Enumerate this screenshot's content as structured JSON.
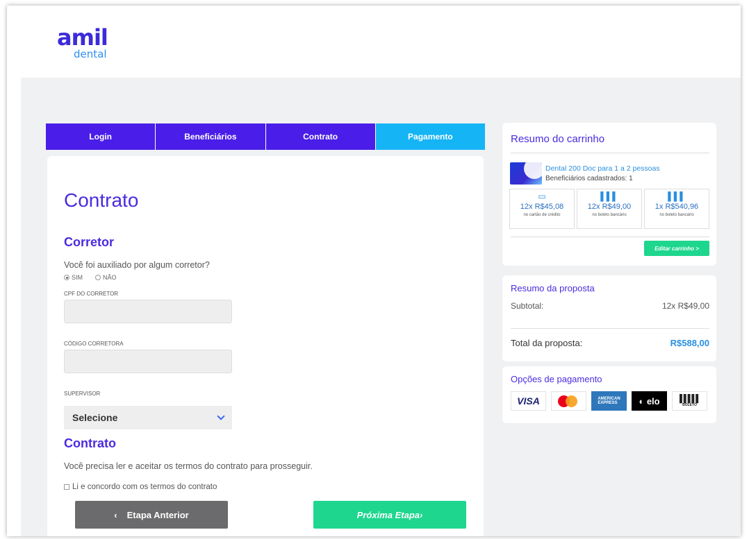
{
  "brand": {
    "name": "amil",
    "sub": "dental"
  },
  "steps": [
    {
      "label": "Login"
    },
    {
      "label": "Beneficiários"
    },
    {
      "label": "Contrato"
    },
    {
      "label": "Pagamento"
    }
  ],
  "form": {
    "title": "Contrato",
    "corretor": {
      "title": "Corretor",
      "question": "Você foi auxiliado por algum corretor?",
      "opt_yes": "SIM",
      "opt_no": "NÃO",
      "cpf_label": "CPF DO CORRETOR",
      "codigo_label": "CÓDIGO CORRETORA",
      "supervisor_label": "SUPERVISOR",
      "supervisor_value": "Selecione"
    },
    "contrato": {
      "title": "Contrato",
      "text": "Você precisa ler e aceitar os termos do contrato para prosseguir.",
      "checkbox": "Li e concordo com os termos do contrato"
    },
    "prev_button": "Etapa Anterior",
    "prev_arrow": "‹",
    "next_button": "Próxima Etapa›"
  },
  "cart": {
    "title": "Resumo do carrinho",
    "product": "Dental 200 Doc para 1 a 2 pessoas",
    "beneficiaries": "Beneficiários cadastrados: 1",
    "options": [
      {
        "icon": "credit-card-icon",
        "price": "12x R$45,08",
        "sub": "no cartão de crédito"
      },
      {
        "icon": "barcode-icon",
        "price": "12x R$49,00",
        "sub": "no boleto bancário"
      },
      {
        "icon": "barcode-icon",
        "price": "1x R$540,96",
        "sub": "no boleto bancário"
      }
    ],
    "edit_button": "Editar carrinho >"
  },
  "proposal": {
    "title": "Resumo da proposta",
    "subtotal_label": "Subtotal:",
    "subtotal_value": "12x R$49,00",
    "total_label": "Total da proposta:",
    "total_value": "R$588,00"
  },
  "payment": {
    "title": "Opções de pagamento",
    "methods": [
      "VISA",
      "Mastercard",
      "American Express",
      "elo",
      "BOLETO"
    ]
  },
  "colors": {
    "primary": "#4a1ee8",
    "active_step": "#15b4f5",
    "accent_green": "#1ed68e",
    "link_blue": "#2a8fe0"
  }
}
